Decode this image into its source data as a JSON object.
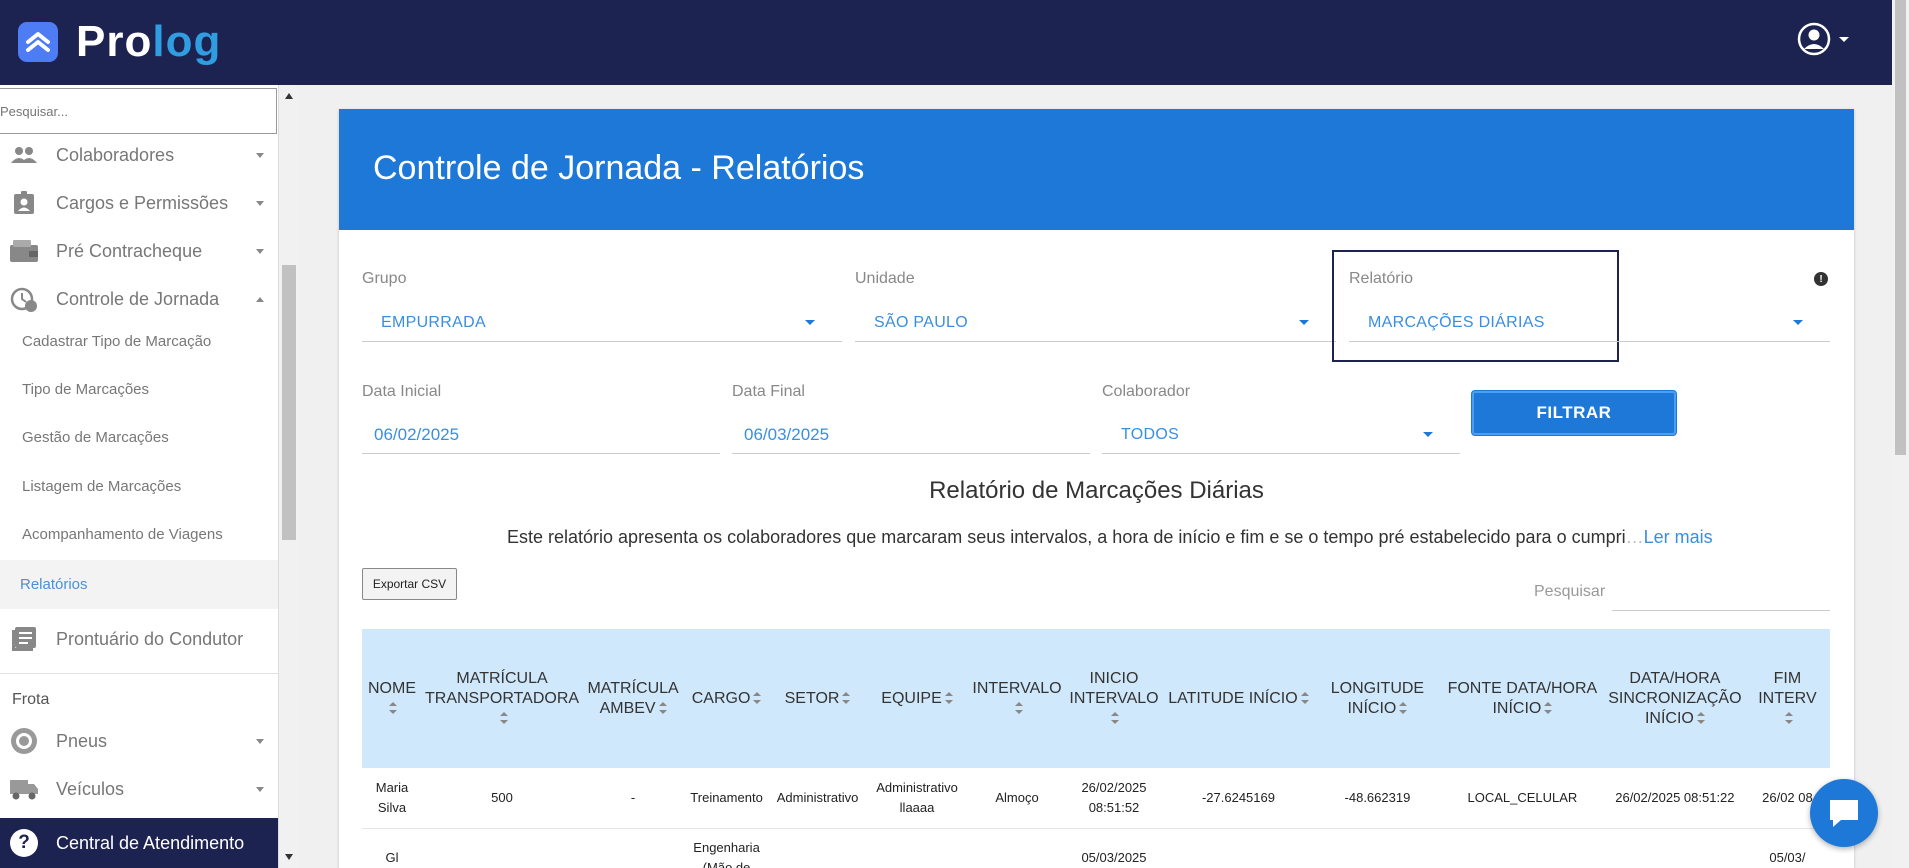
{
  "app": {
    "logo_pre": "Pro",
    "logo_post": "log"
  },
  "sidebar": {
    "search_placeholder": "Pesquisar...",
    "items": [
      {
        "label": "Colaboradores",
        "icon": "people-icon"
      },
      {
        "label": "Cargos e Permissões",
        "icon": "badge-icon"
      },
      {
        "label": "Pré Contracheque",
        "icon": "wallet-icon"
      },
      {
        "label": "Controle de Jornada",
        "icon": "clock-icon"
      }
    ],
    "subitems": [
      {
        "label": "Cadastrar Tipo de Marcação"
      },
      {
        "label": "Tipo de Marcações"
      },
      {
        "label": "Gestão de Marcações"
      },
      {
        "label": "Listagem de Marcações"
      },
      {
        "label": "Acompanhamento de Viagens"
      },
      {
        "label": "Relatórios",
        "active": true
      }
    ],
    "prontuario": "Prontuário do Condutor",
    "section_frota": "Frota",
    "frota_items": [
      {
        "label": "Pneus",
        "icon": "tire-icon"
      },
      {
        "label": "Veículos",
        "icon": "truck-icon"
      }
    ],
    "help": "Central de Atendimento"
  },
  "page": {
    "title": "Controle de Jornada - Relatórios",
    "filters": {
      "grupo_label": "Grupo",
      "grupo_value": "EMPURRADA",
      "unidade_label": "Unidade",
      "unidade_value": "SÃO PAULO",
      "relatorio_label": "Relatório",
      "relatorio_value": "MARCAÇÕES DIÁRIAS",
      "data_inicial_label": "Data Inicial",
      "data_inicial_value": "06/02/2025",
      "data_final_label": "Data Final",
      "data_final_value": "06/03/2025",
      "colaborador_label": "Colaborador",
      "colaborador_value": "TODOS",
      "filter_button": "FILTRAR"
    },
    "report_title": "Relatório de Marcações Diárias",
    "report_desc": "Este relatório apresenta os colaboradores que marcaram seus intervalos, a hora de início e fim e se o tempo pré estabelecido para o cumpri",
    "report_desc_fade": "…",
    "read_more": "Ler mais",
    "export_csv": "Exportar CSV",
    "search_label": "Pesquisar"
  },
  "table": {
    "headers": [
      "NOME",
      "MATRÍCULA TRANSPORTADORA",
      "MATRÍCULA AMBEV",
      "CARGO",
      "SETOR",
      "EQUIPE",
      "INTERVALO",
      "INICIO INTERVALO",
      "LATITUDE INÍCIO",
      "LONGITUDE INÍCIO",
      "FONTE DATA/HORA INÍCIO",
      "DATA/HORA SINCRONIZAÇÃO INÍCIO",
      "FIM INTERV"
    ],
    "rows": [
      [
        "Maria Silva",
        "500",
        "-",
        "Treinamento",
        "Administrativo",
        "Administrativo llaaaa",
        "Almoço",
        "26/02/2025 08:51:52",
        "-27.6245169",
        "-48.662319",
        "LOCAL_CELULAR",
        "26/02/2025 08:51:22",
        "26/02 08"
      ],
      [
        "Gl",
        "",
        "",
        "Engenharia (Mão de",
        "",
        "",
        "",
        "05/03/2025",
        "",
        "",
        "",
        "",
        "05/03/"
      ]
    ]
  }
}
